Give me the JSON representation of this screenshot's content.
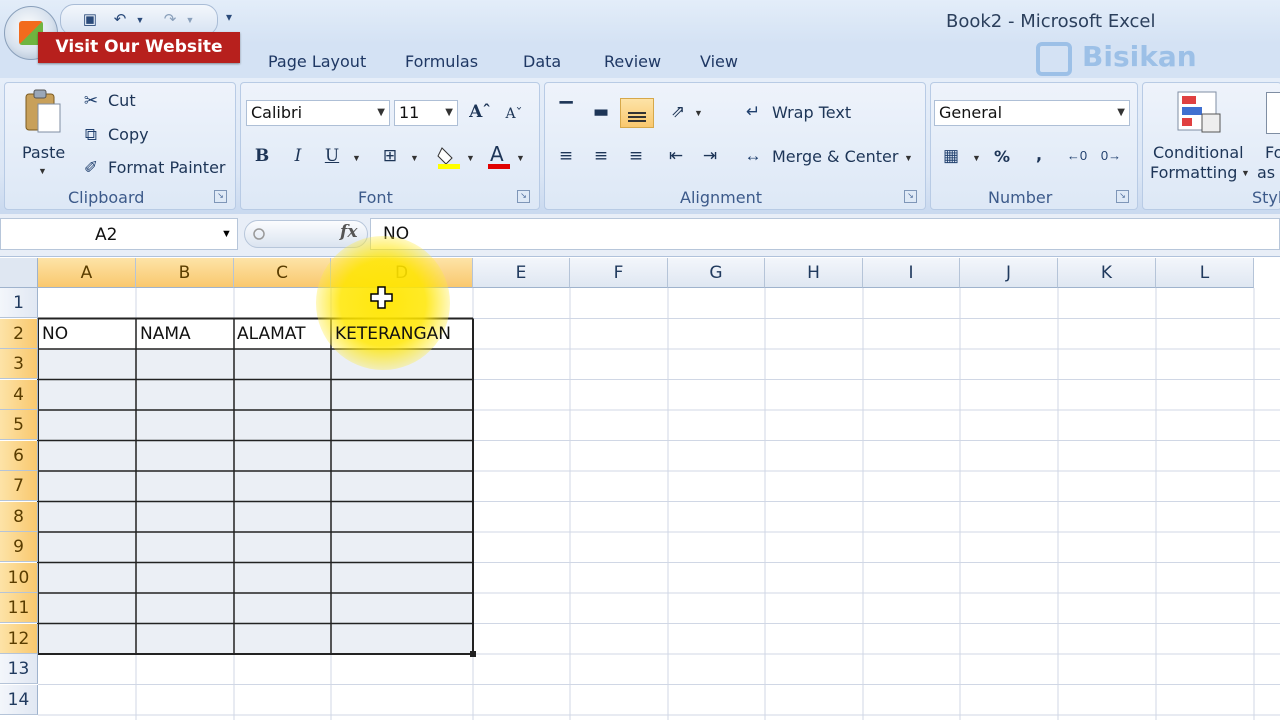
{
  "window": {
    "title": "Book2 - Microsoft Excel"
  },
  "overlay": {
    "banner": "Visit Our Website",
    "watermark": "Bisikan"
  },
  "tabs": [
    "Page Layout",
    "Formulas",
    "Data",
    "Review",
    "View"
  ],
  "ribbon": {
    "clipboard": {
      "paste": "Paste",
      "cut": "Cut",
      "copy": "Copy",
      "format_painter": "Format Painter",
      "label": "Clipboard"
    },
    "font": {
      "name": "Calibri",
      "size": "11",
      "label": "Font",
      "bold": "B",
      "italic": "I",
      "underline": "U"
    },
    "alignment": {
      "wrap_text": "Wrap Text",
      "merge_center": "Merge & Center",
      "label": "Alignment"
    },
    "number": {
      "format": "General",
      "percent": "%",
      "comma": ",",
      "label": "Number"
    },
    "styles": {
      "conditional_line1": "Conditional",
      "conditional_line2": "Formatting",
      "format_as_line1": "Fo",
      "format_as_line2": "as T",
      "label": "Styl"
    }
  },
  "formula_bar": {
    "name_box": "A2",
    "fx": "fx",
    "value": "NO"
  },
  "sheet": {
    "columns": [
      "A",
      "B",
      "C",
      "D",
      "E",
      "F",
      "G",
      "H",
      "I",
      "J",
      "K",
      "L"
    ],
    "rows": [
      "1",
      "2",
      "3",
      "4",
      "5",
      "6",
      "7",
      "8",
      "9",
      "10",
      "11",
      "12",
      "13",
      "14"
    ],
    "headers": [
      "NO",
      "NAMA",
      "ALAMAT",
      "KETERANGAN"
    ]
  },
  "colors": {
    "accent": "#f9c86e",
    "banner": "#b7201d",
    "highlight": "#ffe600"
  }
}
